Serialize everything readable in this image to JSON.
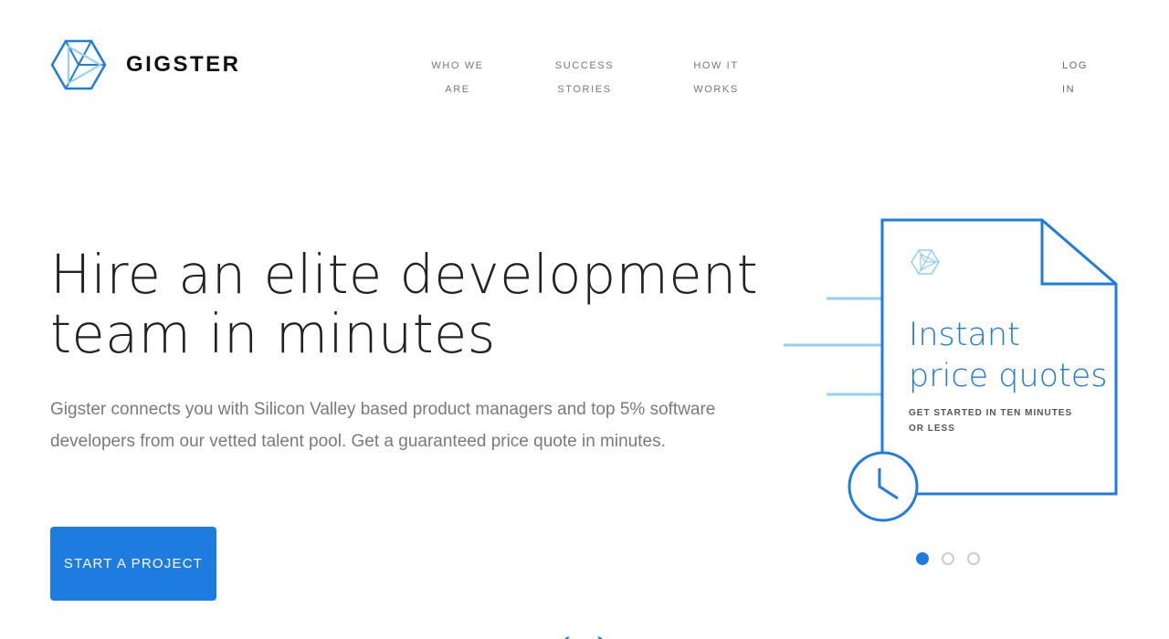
{
  "brand": {
    "name": "GIGSTER",
    "accent_color": "#1e7bdf",
    "logo_icon": "hexagon-cube-icon"
  },
  "nav": {
    "items": [
      {
        "line1": "WHO WE",
        "line2": "ARE"
      },
      {
        "line1": "SUCCESS",
        "line2": "STORIES"
      },
      {
        "line1": "HOW IT",
        "line2": "WORKS"
      }
    ],
    "login": {
      "line1": "LOG",
      "line2": "IN"
    }
  },
  "hero": {
    "headline_line1": "Hire an elite development",
    "headline_line2": "team in minutes",
    "subtext": "Gigster connects you with Silicon Valley based product managers and top 5% software developers from our vetted talent pool. Get a guaranteed price quote in minutes.",
    "cta_label": "START A PROJECT"
  },
  "slide": {
    "title_line1": "Instant",
    "title_line2": "price quotes",
    "subtitle_line1": "GET STARTED IN TEN MINUTES",
    "subtitle_line2": "OR LESS",
    "icons": [
      "document-icon",
      "clock-icon",
      "hexagon-cube-icon"
    ]
  },
  "carousel": {
    "slide_count": 3,
    "active_index": 0
  }
}
